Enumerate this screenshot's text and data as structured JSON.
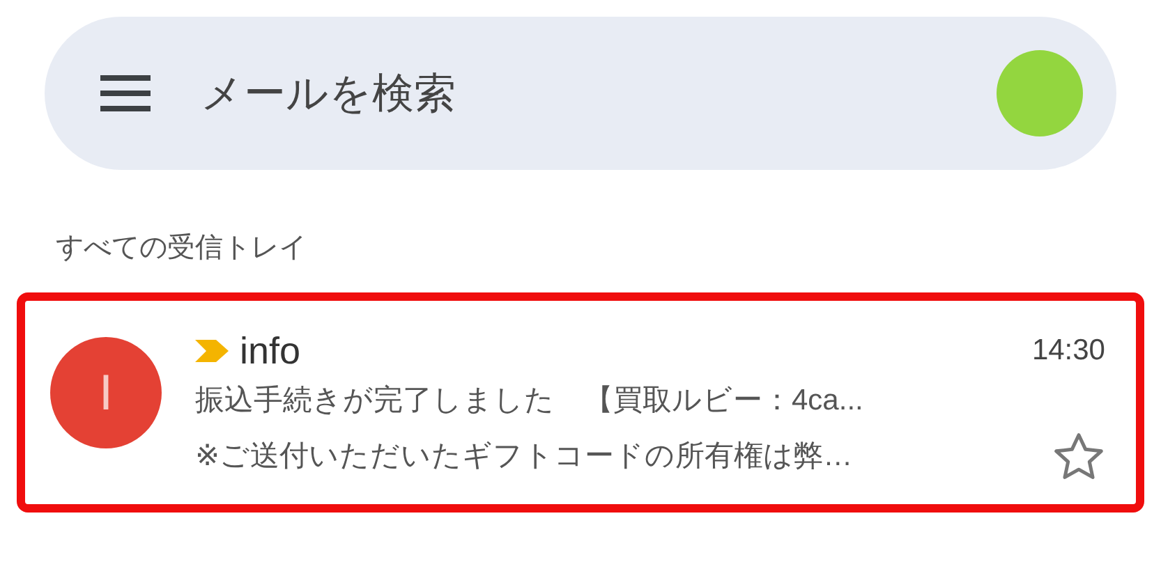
{
  "search": {
    "placeholder": "メールを検索"
  },
  "section_label": "すべての受信トレイ",
  "emails": [
    {
      "avatar_letter": "I",
      "sender": "info",
      "important": true,
      "time": "14:30",
      "subject": "振込手続きが完了しました　【買取ルビー：4ca...",
      "snippet": "※ご送付いただいたギフトコードの所有権は弊…",
      "starred": false,
      "highlighted": true
    }
  ]
}
